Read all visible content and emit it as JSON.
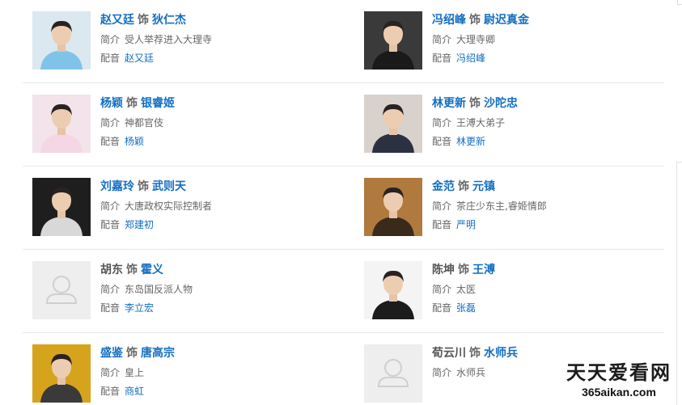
{
  "cast": [
    {
      "actor": "赵又廷",
      "actor_link": true,
      "as": "饰",
      "role": "狄仁杰",
      "intro_label": "简介",
      "intro": "受人举荐进入大理寺",
      "dub_label": "配音",
      "dub": "赵又廷",
      "photo": "actor-photo",
      "bg": "#dbe8f0",
      "shirt": "#7fc4e8"
    },
    {
      "actor": "冯绍峰",
      "actor_link": true,
      "as": "饰",
      "role": "尉迟真金",
      "intro_label": "简介",
      "intro": "大理寺卿",
      "dub_label": "配音",
      "dub": "冯绍峰",
      "photo": "actor-photo",
      "bg": "#3a3a3a",
      "shirt": "#1a1a1a"
    },
    {
      "actor": "杨颖",
      "actor_link": true,
      "as": "饰",
      "role": "银睿姬",
      "intro_label": "简介",
      "intro": "神都官伎",
      "dub_label": "配音",
      "dub": "杨颖",
      "photo": "actor-photo",
      "bg": "#f2e4ea",
      "shirt": "#f5d6e4"
    },
    {
      "actor": "林更新",
      "actor_link": true,
      "as": "饰",
      "role": "沙陀忠",
      "intro_label": "简介",
      "intro": "王溥大弟子",
      "dub_label": "配音",
      "dub": "林更新",
      "photo": "actor-photo",
      "bg": "#d9d2cc",
      "shirt": "#2c3142"
    },
    {
      "actor": "刘嘉玲",
      "actor_link": true,
      "as": "饰",
      "role": "武则天",
      "intro_label": "简介",
      "intro": "大唐政权实际控制者",
      "dub_label": "配音",
      "dub": "郑建初",
      "photo": "actor-photo",
      "bg": "#1e1e1e",
      "shirt": "#d8d8d8"
    },
    {
      "actor": "金范",
      "actor_link": true,
      "as": "饰",
      "role": "元镇",
      "intro_label": "简介",
      "intro": "茶庄少东主,睿姬情郎",
      "dub_label": "配音",
      "dub": "严明",
      "photo": "actor-photo",
      "bg": "#b07a3e",
      "shirt": "#3a2a1c"
    },
    {
      "actor": "胡东",
      "actor_link": false,
      "as": "饰",
      "role": "霍义",
      "intro_label": "简介",
      "intro": "东岛国反派人物",
      "dub_label": "配音",
      "dub": "李立宏",
      "photo": "placeholder",
      "bg": "#eeeeee",
      "shirt": "#dddddd"
    },
    {
      "actor": "陈坤",
      "actor_link": false,
      "as": "饰",
      "role": "王溥",
      "intro_label": "简介",
      "intro": "太医",
      "dub_label": "配音",
      "dub": "张磊",
      "photo": "actor-photo",
      "bg": "#f4f4f4",
      "shirt": "#1c1c1c"
    },
    {
      "actor": "盛鉴",
      "actor_link": true,
      "as": "饰",
      "role": "唐高宗",
      "intro_label": "简介",
      "intro": "皇上",
      "dub_label": "配音",
      "dub": "商虹",
      "photo": "actor-photo",
      "bg": "#d6a41c",
      "shirt": "#3a3a3a"
    },
    {
      "actor": "荀云川",
      "actor_link": false,
      "as": "饰",
      "role": "水师兵",
      "intro_label": "简介",
      "intro": "水师兵",
      "dub_label": null,
      "dub": null,
      "photo": "placeholder",
      "bg": "#eeeeee",
      "shirt": "#dddddd"
    }
  ],
  "watermark": {
    "title": "天天爱看网",
    "url": "365aikan.com"
  }
}
